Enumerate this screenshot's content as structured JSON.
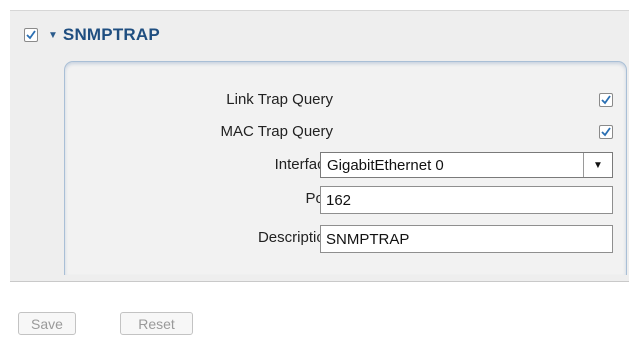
{
  "section": {
    "enabled": true,
    "title": "SNMPTRAP"
  },
  "form": {
    "link_trap_query": {
      "label": "Link Trap Query",
      "checked": true
    },
    "mac_trap_query": {
      "label": "MAC Trap Query",
      "checked": true
    },
    "interface": {
      "label": "Interface",
      "value": "GigabitEthernet 0"
    },
    "port": {
      "label": "Port",
      "value": "162"
    },
    "description": {
      "label": "Description",
      "value": "SNMPTRAP"
    }
  },
  "footer": {
    "save_label": "Save",
    "reset_label": "Reset"
  },
  "colors": {
    "title": "#1f4e80",
    "check": "#2a6fb3",
    "panel_bg": "#eeeeee"
  }
}
